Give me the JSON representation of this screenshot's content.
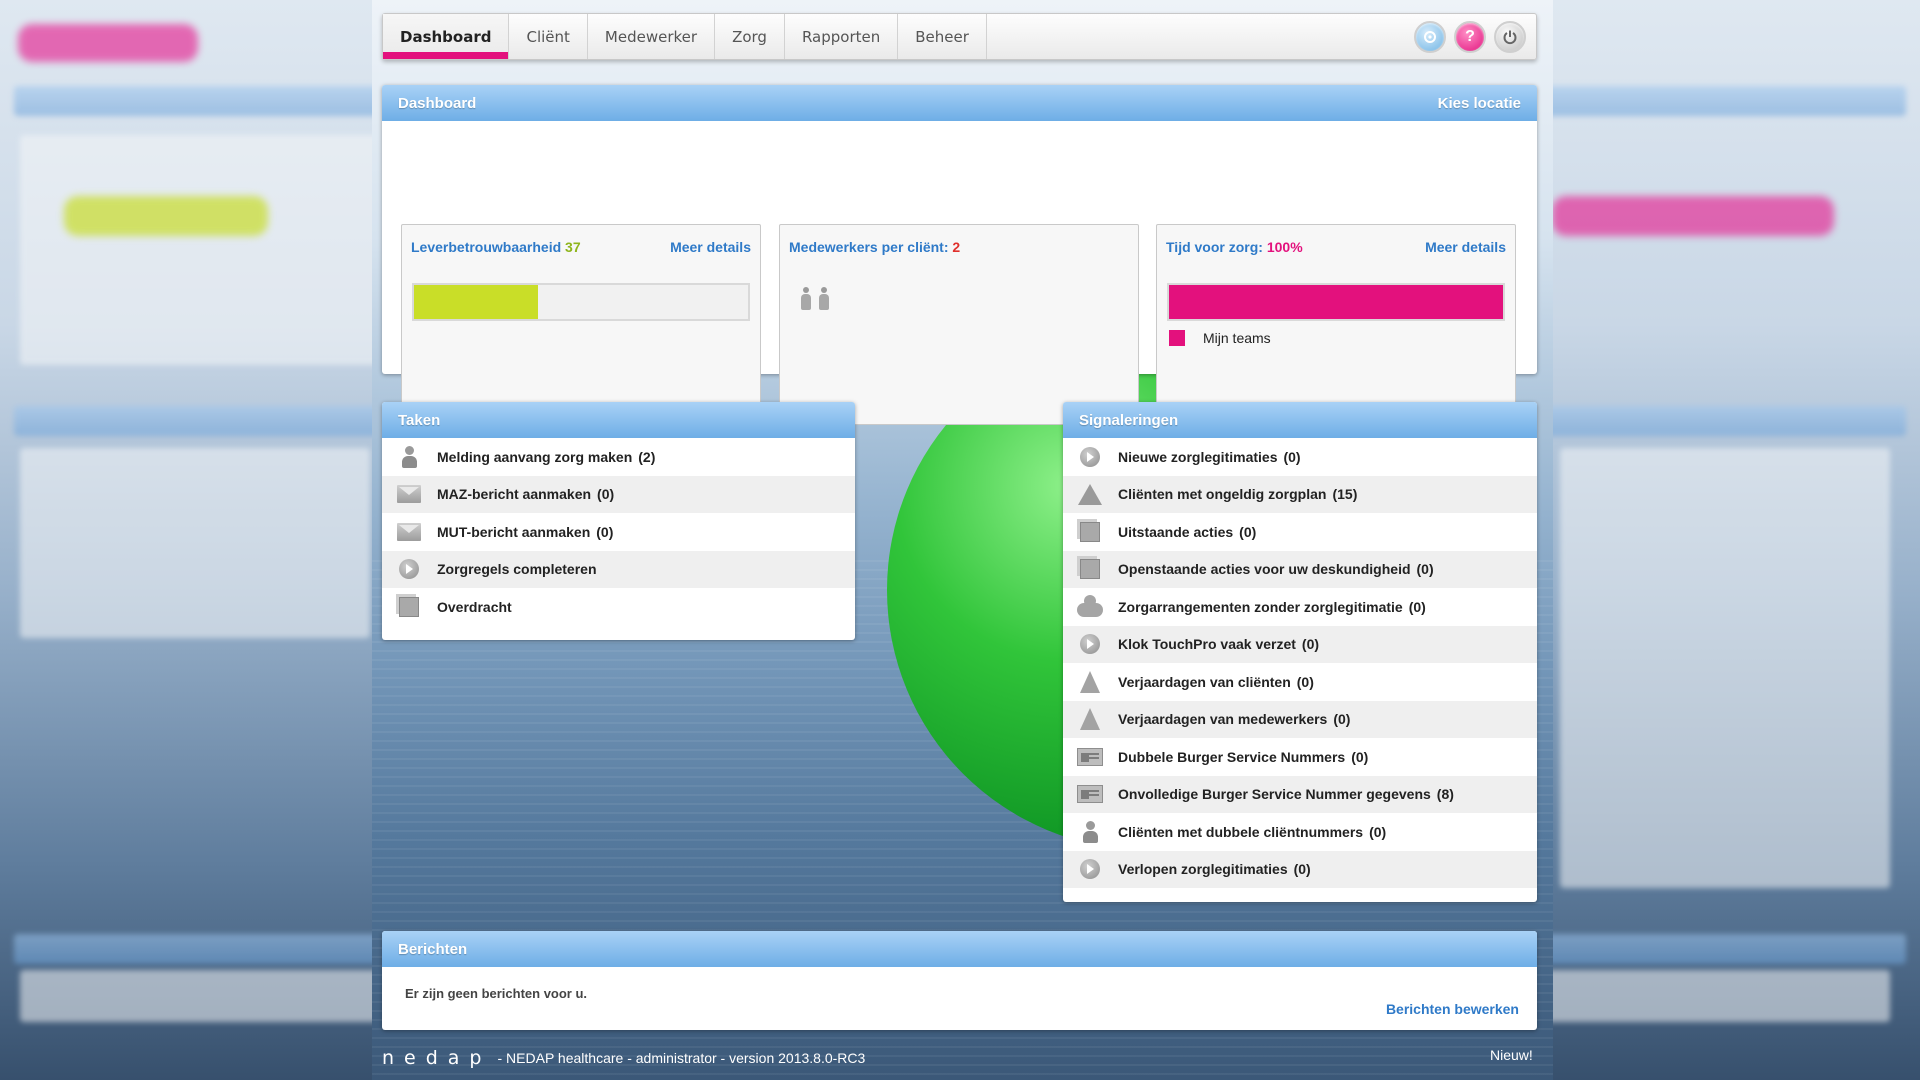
{
  "nav": {
    "tabs": [
      {
        "label": "Dashboard"
      },
      {
        "label": "Cliënt"
      },
      {
        "label": "Medewerker"
      },
      {
        "label": "Zorg"
      },
      {
        "label": "Rapporten"
      },
      {
        "label": "Beheer"
      }
    ],
    "active_tab": "Dashboard",
    "icons": [
      "settings-icon",
      "help-icon",
      "power-icon"
    ]
  },
  "dashboard": {
    "title": "Dashboard",
    "location_link": "Kies locatie",
    "widgets": {
      "reliability": {
        "label": "Leverbetrouwbaarheid",
        "value": "37",
        "link": "Meer details",
        "fill_fraction": 0.37
      },
      "staff_per_client": {
        "label": "Medewerkers per cliënt:",
        "value": "2",
        "icon": "people-icon"
      },
      "care_time": {
        "label": "Tijd voor zorg:",
        "value": "100%",
        "link": "Meer details",
        "fill_fraction": 1.0,
        "legend": "Mijn teams"
      }
    }
  },
  "taken": {
    "title": "Taken",
    "items": [
      {
        "label": "Melding aanvang zorg maken",
        "count": "(2)",
        "icon": "person-icon"
      },
      {
        "label": "MAZ-bericht aanmaken",
        "count": "(0)",
        "icon": "envelope-icon"
      },
      {
        "label": "MUT-bericht aanmaken",
        "count": "(0)",
        "icon": "envelope-icon"
      },
      {
        "label": "Zorgregels completeren",
        "count": "",
        "icon": "circle-arrow-icon"
      },
      {
        "label": "Overdracht",
        "count": "",
        "icon": "documents-icon"
      }
    ]
  },
  "signaleringen": {
    "title": "Signaleringen",
    "items": [
      {
        "label": "Nieuwe zorglegitimaties",
        "count": "(0)",
        "icon": "play-icon"
      },
      {
        "label": "Cliënten met ongeldig zorgplan",
        "count": "(15)",
        "icon": "warning-icon"
      },
      {
        "label": "Uitstaande acties",
        "count": "(0)",
        "icon": "documents-icon"
      },
      {
        "label": "Openstaande acties voor uw deskundigheid",
        "count": "(0)",
        "icon": "documents-icon"
      },
      {
        "label": "Zorgarrangementen zonder zorglegitimatie",
        "count": "(0)",
        "icon": "cloud-icon"
      },
      {
        "label": "Klok TouchPro vaak verzet",
        "count": "(0)",
        "icon": "clock-icon"
      },
      {
        "label": "Verjaardagen van cliënten",
        "count": "(0)",
        "icon": "party-hat-icon"
      },
      {
        "label": "Verjaardagen van medewerkers",
        "count": "(0)",
        "icon": "party-hat-icon"
      },
      {
        "label": "Dubbele Burger Service Nummers",
        "count": "(0)",
        "icon": "id-card-icon"
      },
      {
        "label": "Onvolledige Burger Service Nummer gegevens",
        "count": "(8)",
        "icon": "id-card-icon"
      },
      {
        "label": "Cliënten met dubbele cliëntnummers",
        "count": "(0)",
        "icon": "people-icon"
      },
      {
        "label": "Verlopen zorglegitimaties",
        "count": "(0)",
        "icon": "play-icon"
      }
    ]
  },
  "berichten": {
    "title": "Berichten",
    "empty_text": "Er zijn geen berichten voor u.",
    "edit_link": "Berichten bewerken"
  },
  "footer": {
    "logo": "nedap",
    "text": "- NEDAP healthcare - administrator - version 2013.8.0-RC3",
    "new_link": "Nieuw!"
  },
  "colors": {
    "accent_pink": "#e3117d",
    "accent_green": "#c9de28",
    "link_blue": "#2f7ac8",
    "header_blue": "#6eaee6"
  }
}
